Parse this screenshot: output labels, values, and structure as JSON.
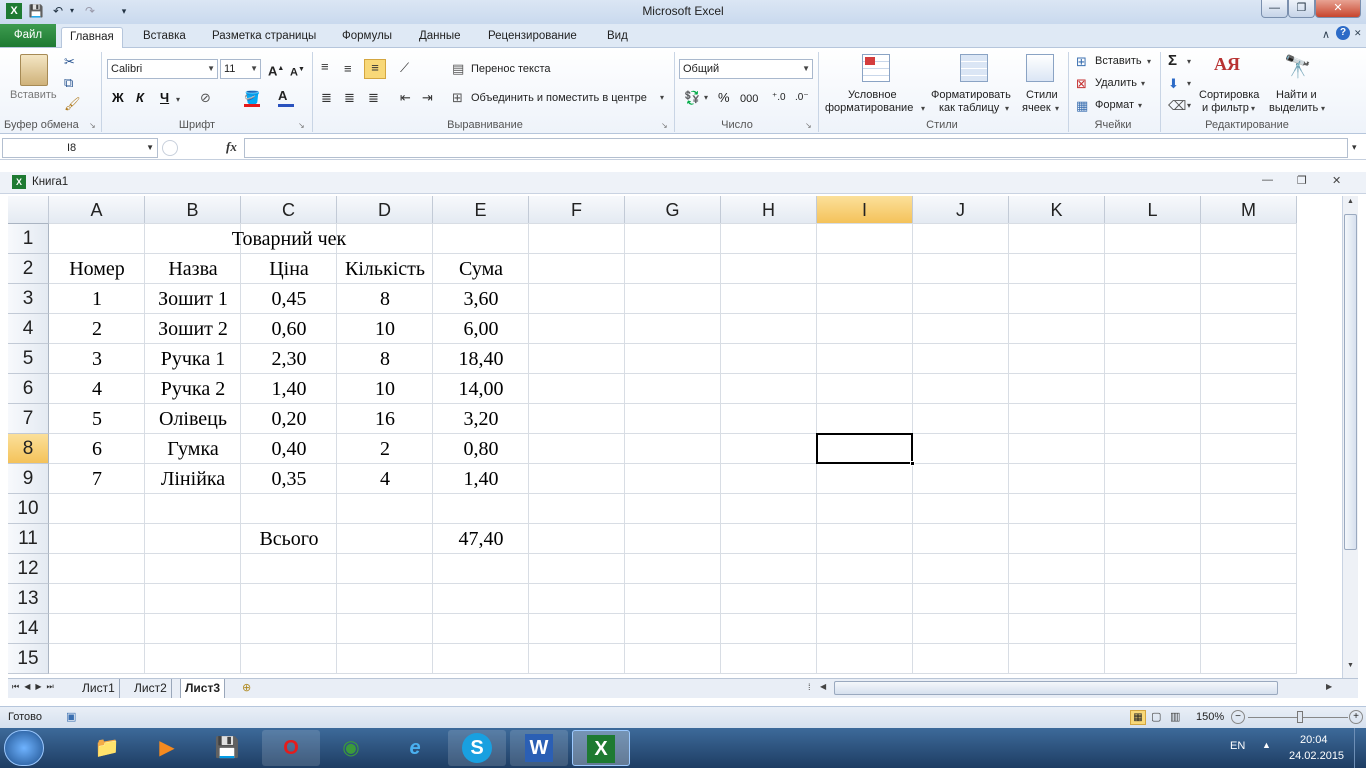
{
  "window": {
    "title": "Microsoft Excel"
  },
  "tabs": [
    "Файл",
    "Главная",
    "Вставка",
    "Разметка страницы",
    "Формулы",
    "Данные",
    "Рецензирование",
    "Вид"
  ],
  "ribbon": {
    "clipboard": {
      "paste": "Вставить",
      "group": "Буфер обмена"
    },
    "font": {
      "name": "Calibri",
      "size": "11",
      "bold": "Ж",
      "italic": "К",
      "underline": "Ч",
      "group": "Шрифт"
    },
    "alignment": {
      "wrap": "Перенос текста",
      "merge": "Объединить и поместить в центре",
      "group": "Выравнивание"
    },
    "number": {
      "format": "Общий",
      "percent": "%",
      "thousands": "000",
      "group": "Число"
    },
    "styles": {
      "conditional1": "Условное",
      "conditional2": "форматирование",
      "table1": "Форматировать",
      "table2": "как таблицу",
      "cell1": "Стили",
      "cell2": "ячеек",
      "group": "Стили"
    },
    "cells": {
      "insert": "Вставить",
      "delete": "Удалить",
      "format": "Формат",
      "group": "Ячейки"
    },
    "editing": {
      "sort1": "Сортировка",
      "sort2": "и фильтр",
      "find1": "Найти и",
      "find2": "выделить",
      "group": "Редактирование"
    }
  },
  "formula_bar": {
    "name_box": "I8",
    "fx": "fx",
    "value": ""
  },
  "workbook": {
    "name": "Книга1"
  },
  "columns": [
    "A",
    "B",
    "C",
    "D",
    "E",
    "F",
    "G",
    "H",
    "I",
    "J",
    "K",
    "L",
    "M"
  ],
  "rows": [
    "1",
    "2",
    "3",
    "4",
    "5",
    "6",
    "7",
    "8",
    "9",
    "10",
    "11",
    "12",
    "13",
    "14",
    "15"
  ],
  "selected": {
    "column": "I",
    "row": "8"
  },
  "sheet": {
    "title": "Товарний чек",
    "headers": [
      "Номер",
      "Назва",
      "Ціна",
      "Кількість",
      "Сума"
    ],
    "items": [
      [
        "1",
        "Зошит 1",
        "0,45",
        "8",
        "3,60"
      ],
      [
        "2",
        "Зошит 2",
        "0,60",
        "10",
        "6,00"
      ],
      [
        "3",
        "Ручка 1",
        "2,30",
        "8",
        "18,40"
      ],
      [
        "4",
        "Ручка 2",
        "1,40",
        "10",
        "14,00"
      ],
      [
        "5",
        "Олівець",
        "0,20",
        "16",
        "3,20"
      ],
      [
        "6",
        "Гумка",
        "0,40",
        "2",
        "0,80"
      ],
      [
        "7",
        "Лінійка",
        "0,35",
        "4",
        "1,40"
      ]
    ],
    "total_label": "Всього",
    "total_value": "47,40"
  },
  "sheet_tabs": [
    "Лист1",
    "Лист2",
    "Лист3"
  ],
  "active_sheet": "Лист3",
  "status": {
    "ready": "Готово",
    "zoom": "150%"
  },
  "taskbar": {
    "lang": "EN",
    "time": "20:04",
    "date": "24.02.2015"
  },
  "colors": {
    "file_tab": "#1e7a32",
    "selection_header": "#f4c25a",
    "taskbar": "#2b4f7c"
  }
}
